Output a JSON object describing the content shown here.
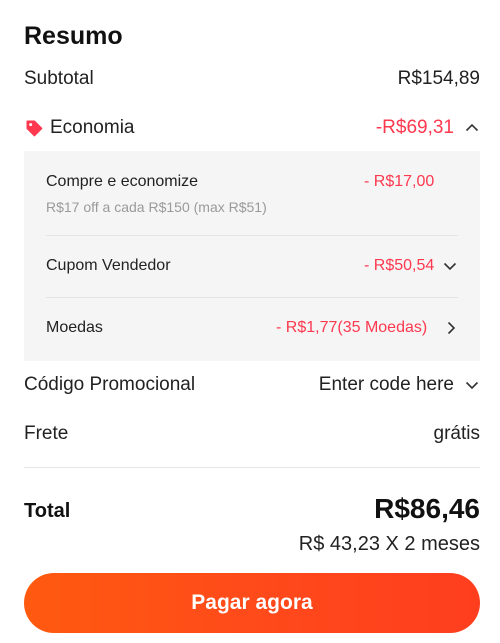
{
  "summary": {
    "title": "Resumo",
    "subtotal_label": "Subtotal",
    "subtotal_value": "R$154,89",
    "savings_label": "Economia",
    "savings_value": "-R$69,31",
    "savings_icon": "tag-icon",
    "breakdown": {
      "items": [
        {
          "label": "Compre e economize",
          "detail": "R$17 off a cada R$150 (max R$51)",
          "value": "- R$17,00"
        },
        {
          "label": "Cupom Vendedor",
          "value": "- R$50,54"
        },
        {
          "label": "Moedas",
          "value": "- R$1,77(35 Moedas)"
        }
      ]
    },
    "promo_label": "Código Promocional",
    "promo_placeholder": "Enter code here",
    "shipping_label": "Frete",
    "shipping_value": "grátis",
    "total_label": "Total",
    "total_value": "R$86,46",
    "installments": "R$ 43,23 X 2 meses",
    "pay_button": "Pagar agora"
  },
  "colors": {
    "accent": "#fd384f",
    "button_start": "#ff5a10",
    "button_end": "#ff3e1e",
    "panel_bg": "#f5f5f5"
  }
}
